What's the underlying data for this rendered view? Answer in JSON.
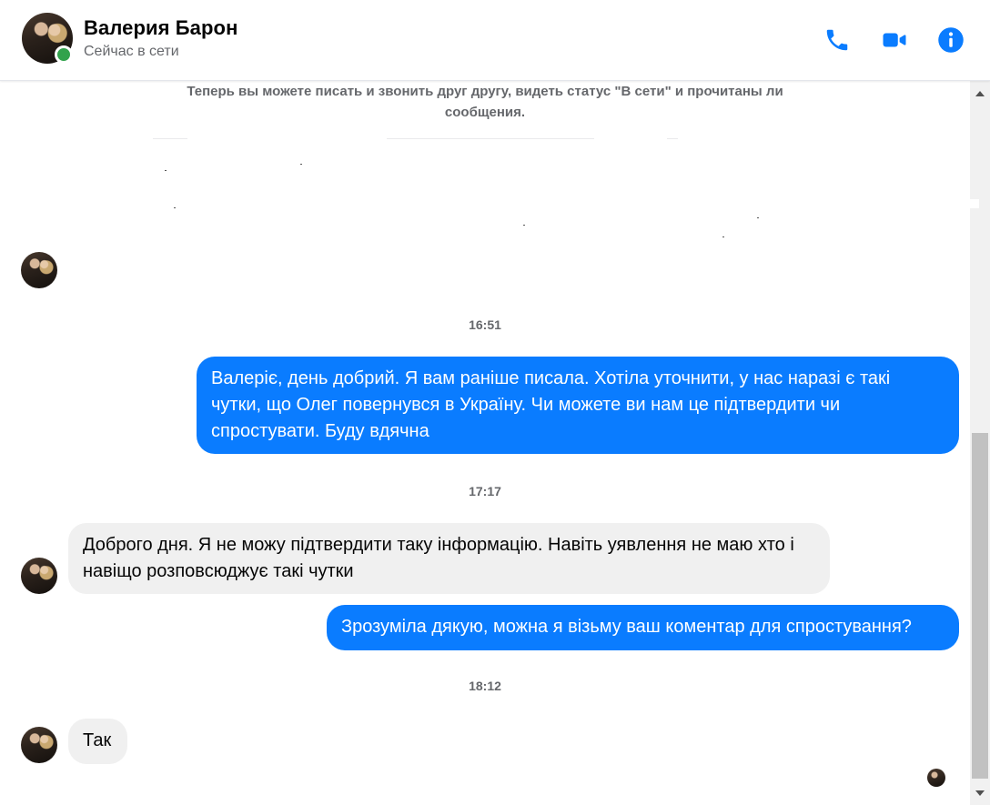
{
  "header": {
    "contact_name": "Валерия Барон",
    "status": "Сейчас в сети"
  },
  "system_note": "Теперь вы можете писать и звонить друг другу, видеть статус \"В сети\" и прочитаны ли сообщения.",
  "timestamps": [
    "16:51",
    "17:17",
    "18:12"
  ],
  "messages": [
    {
      "direction": "outgoing",
      "text": "Валеріє, день добрий. Я вам раніше писала. Хотіла уточнити, у нас наразі є такі чутки, що Олег повернувся в Україну. Чи можете ви нам це підтвердити чи спростувати. Буду вдячна"
    },
    {
      "direction": "incoming",
      "text": "Доброго дня. Я не можу підтвердити таку інформацію. Навіть уявлення не маю хто і навіщо розповсюджує такі чутки"
    },
    {
      "direction": "outgoing",
      "text": "Зрозуміла дякую, можна я візьму ваш коментар для спростування?"
    },
    {
      "direction": "incoming",
      "text": "Так"
    }
  ],
  "icons": {
    "call": "phone-icon",
    "video": "video-camera-icon",
    "info": "info-icon"
  },
  "colors": {
    "accent": "#0a7cff",
    "online": "#31a24c",
    "incoming_bubble": "#f0f0f0",
    "muted_text": "#65676b"
  }
}
